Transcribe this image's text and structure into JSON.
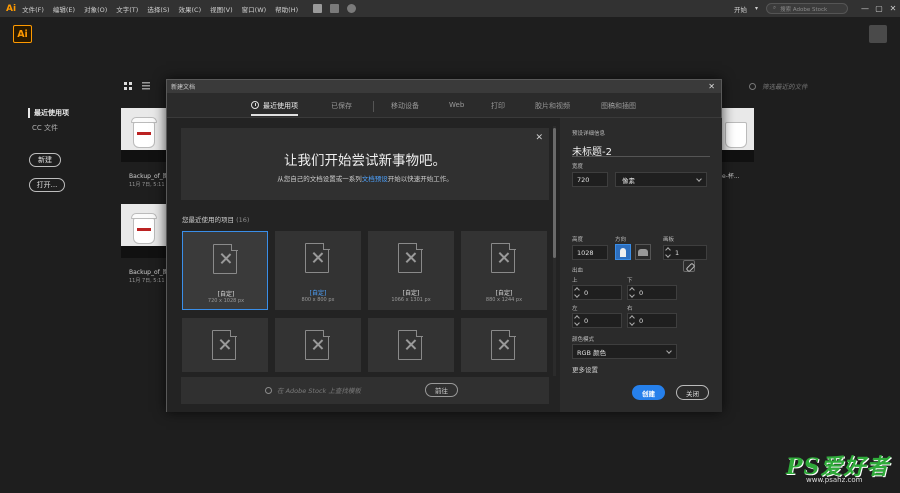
{
  "menubar": {
    "ai_logo": "Ai",
    "items": [
      "文件(F)",
      "编辑(E)",
      "对象(O)",
      "文字(T)",
      "选择(S)",
      "效果(C)",
      "视图(V)",
      "窗口(W)",
      "帮助(H)"
    ],
    "workspace": "开始",
    "stock_placeholder": "搜索 Adobe Stock",
    "min": "—",
    "max": "▢",
    "close": "✕"
  },
  "app": {
    "logo": "Ai"
  },
  "start": {
    "nav": [
      {
        "label": "最近使用项"
      },
      {
        "label": "CC 文件"
      }
    ],
    "new_button": "新建",
    "open_button": "打开...",
    "search_placeholder": "筛选最近的文件",
    "thumbs": [
      {
        "name": "Backup_of_图",
        "date": "11月 7日, 5:11 下午"
      },
      {
        "name": "Backup_of_图",
        "date": "11月 7日, 5:11 下午"
      }
    ],
    "right_thumb_name": "e-杯..."
  },
  "dialog": {
    "title": "新建文档",
    "close": "✕",
    "tabs": [
      {
        "label": "最近使用项"
      },
      {
        "label": "已保存"
      },
      {
        "label": "移动设备"
      },
      {
        "label": "Web"
      },
      {
        "label": "打印"
      },
      {
        "label": "胶片和视频"
      },
      {
        "label": "图稿和插图"
      }
    ],
    "hero": {
      "title": "让我们开始尝试新事物吧。",
      "sub_pre": "从您自己的文档设置或一系列",
      "sub_link": "文档预设",
      "sub_post": "开始以快速开始工作。",
      "close": "✕"
    },
    "recent_title": "您最近使用的项目",
    "recent_count": "(16)",
    "tiles": [
      {
        "name": "[自定]",
        "size": "720 x 1028 px"
      },
      {
        "name": "[自定]",
        "size": "800 x 800 px"
      },
      {
        "name": "[自定]",
        "size": "1066 x 1301 px"
      },
      {
        "name": "[自定]",
        "size": "880 x 1244 px"
      }
    ],
    "stock_search_placeholder": "在 Adobe Stock 上查找模板",
    "go_button": "前往",
    "details": {
      "heading": "预设详细信息",
      "doc_name": "未标题-2",
      "width_label": "宽度",
      "width_value": "720",
      "unit": "像素",
      "height_label": "高度",
      "height_value": "1028",
      "orientation_label": "方向",
      "artboards_label": "画板",
      "artboards_value": "1",
      "bleed_label": "出血",
      "top_label": "上",
      "bottom_label": "下",
      "left_label": "左",
      "right_label": "右",
      "bleed_top": "0",
      "bleed_bottom": "0",
      "bleed_left": "0",
      "bleed_right": "0",
      "color_mode_label": "颜色模式",
      "color_mode": "RGB 颜色",
      "more_settings": "更多设置",
      "create_button": "创建",
      "close_button": "关闭"
    }
  },
  "watermark": {
    "main": "PS爱好者",
    "url": "www.psahz.com"
  },
  "colors": {
    "accent": "#2680eb",
    "ai_orange": "#ff9a00",
    "link_blue": "#4ea3ff"
  }
}
